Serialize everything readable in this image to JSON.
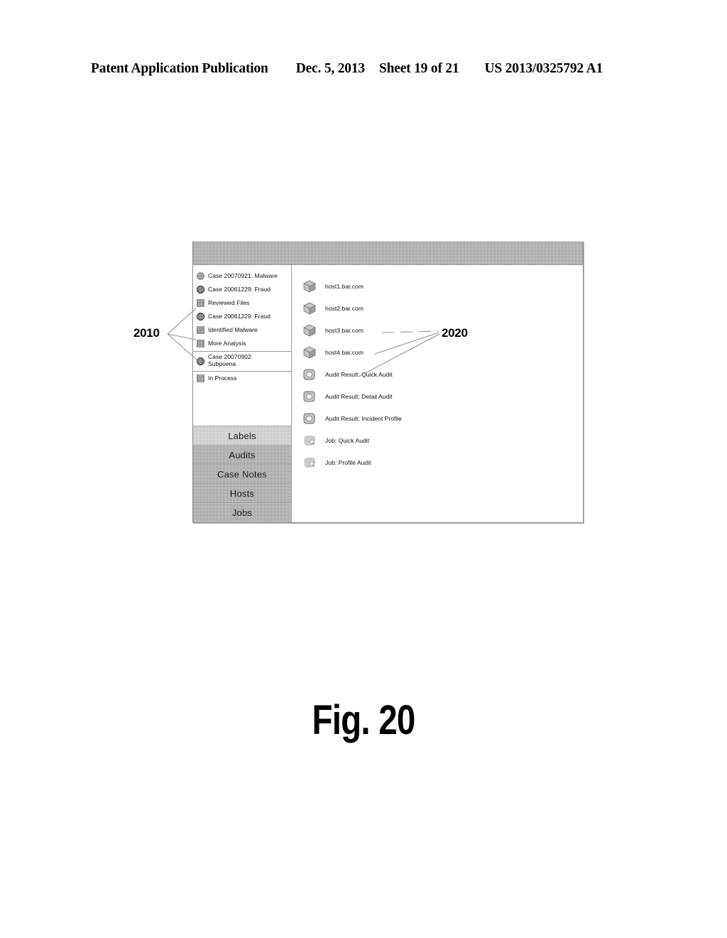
{
  "header": {
    "publication": "Patent Application Publication",
    "date": "Dec. 5, 2013",
    "sheet": "Sheet 19 of 21",
    "patent_number": "US 2013/0325792 A1"
  },
  "figure": {
    "caption": "Fig. 20"
  },
  "reference_numerals": {
    "tree_panel": "2010",
    "object_panel": "2020"
  },
  "window": {
    "title": "",
    "left_panel": {
      "tree_items": [
        {
          "label": "Case 20070921: Malware",
          "icon": "case-light-icon",
          "type": "case"
        },
        {
          "label": "Case 20061229: Fraud",
          "icon": "case-dark-icon",
          "type": "case"
        },
        {
          "label": "Reviewed Files",
          "icon": "label-square-icon",
          "type": "label"
        },
        {
          "label": "Case 20061229: Fraud",
          "icon": "case-dark-icon",
          "type": "case"
        },
        {
          "label": "Identified Malware",
          "icon": "label-square-icon",
          "type": "label"
        },
        {
          "label": "More Analysis",
          "icon": "label-square-icon",
          "type": "label"
        },
        {
          "label": "Case 20070902:\nSubpoena",
          "icon": "case-dark-icon",
          "type": "case"
        },
        {
          "label": "In Process",
          "icon": "label-square-icon",
          "type": "label"
        }
      ],
      "category_buttons": [
        {
          "label": "Labels",
          "selected": true
        },
        {
          "label": "Audits",
          "selected": false
        },
        {
          "label": "Case Notes",
          "selected": false
        },
        {
          "label": "Hosts",
          "selected": false
        },
        {
          "label": "Jobs",
          "selected": false
        }
      ]
    },
    "right_panel": {
      "objects": [
        {
          "label": "host1.bar.com",
          "icon": "host-cube-icon",
          "type": "host"
        },
        {
          "label": "host2.bar.com",
          "icon": "host-cube-icon",
          "type": "host"
        },
        {
          "label": "host3.bar.com",
          "icon": "host-cube-icon",
          "type": "host"
        },
        {
          "label": "host4.bar.com",
          "icon": "host-cube-icon",
          "type": "host"
        },
        {
          "label": "Audit Result: Quick Audit",
          "icon": "audit-result-icon",
          "type": "audit-result"
        },
        {
          "label": "Audit Result: Detail Audit",
          "icon": "audit-result-icon",
          "type": "audit-result"
        },
        {
          "label": "Audit Result: Incident Profile",
          "icon": "audit-result-icon",
          "type": "audit-result"
        },
        {
          "label": "Job: Quick Audit",
          "icon": "job-icon",
          "type": "job"
        },
        {
          "label": "Job: Profile Audit",
          "icon": "job-icon",
          "type": "job"
        }
      ]
    }
  }
}
